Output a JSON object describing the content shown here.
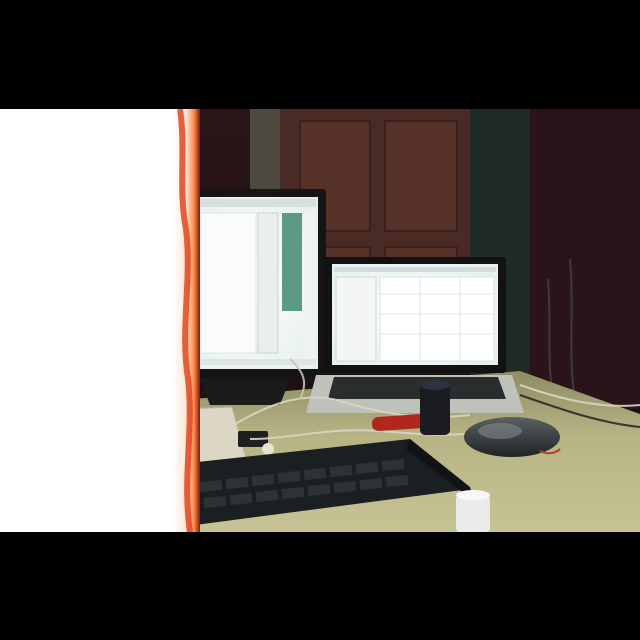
{
  "scene": {
    "palette": {
      "letterbox": "#000000",
      "light_leak": "#ffffff",
      "burn_edge": "#d8401a",
      "wall": "#2a1716",
      "door": "#4a2c24",
      "desk": "#b9b486",
      "screen_glow": "#f2f6f4",
      "accent_green": "#5c9a86",
      "mouse": "#2e3233",
      "keyboard": "#1c2123",
      "cable": "#d9d6c2",
      "red_marker": "#b0281c"
    },
    "objects": [
      "external-monitor",
      "laptop",
      "keyboard",
      "computer-mouse",
      "cables",
      "cup",
      "door",
      "papers",
      "red-marker",
      "mug"
    ]
  }
}
